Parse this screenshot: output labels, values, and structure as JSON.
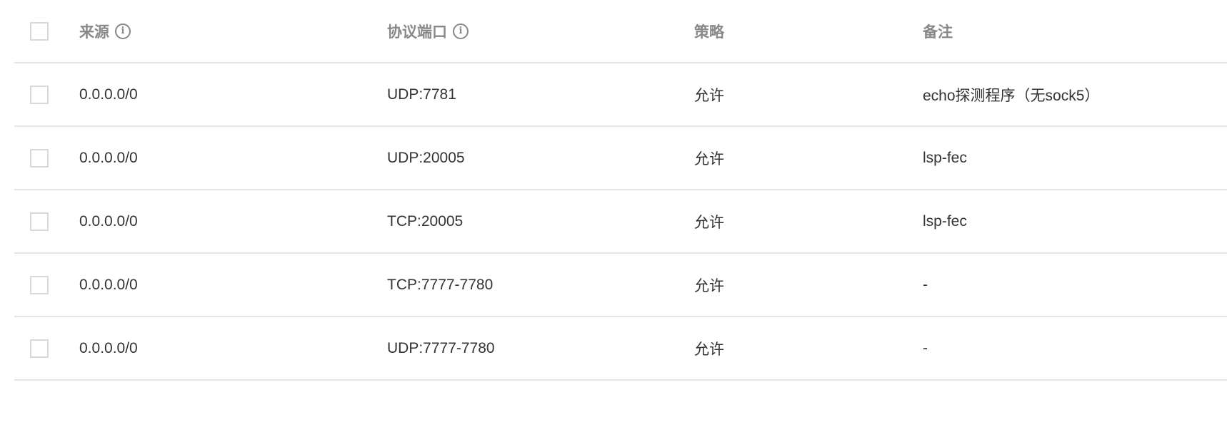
{
  "table": {
    "headers": {
      "source": "来源",
      "port": "协议端口",
      "policy": "策略",
      "note": "备注",
      "info_glyph": "i"
    },
    "rows": [
      {
        "source": "0.0.0.0/0",
        "port": "UDP:7781",
        "policy": "允许",
        "note": "echo探测程序（无sock5）"
      },
      {
        "source": "0.0.0.0/0",
        "port": "UDP:20005",
        "policy": "允许",
        "note": "lsp-fec"
      },
      {
        "source": "0.0.0.0/0",
        "port": "TCP:20005",
        "policy": "允许",
        "note": "lsp-fec"
      },
      {
        "source": "0.0.0.0/0",
        "port": "TCP:7777-7780",
        "policy": "允许",
        "note": "-"
      },
      {
        "source": "0.0.0.0/0",
        "port": "UDP:7777-7780",
        "policy": "允许",
        "note": "-"
      }
    ]
  },
  "icons": {
    "checkbox": "checkbox-unchecked",
    "info": "info-circle-icon"
  },
  "colors": {
    "text": "#333333",
    "header_text": "#888888",
    "border": "#e5e5e5",
    "checkbox_border": "#d9d9d9"
  }
}
